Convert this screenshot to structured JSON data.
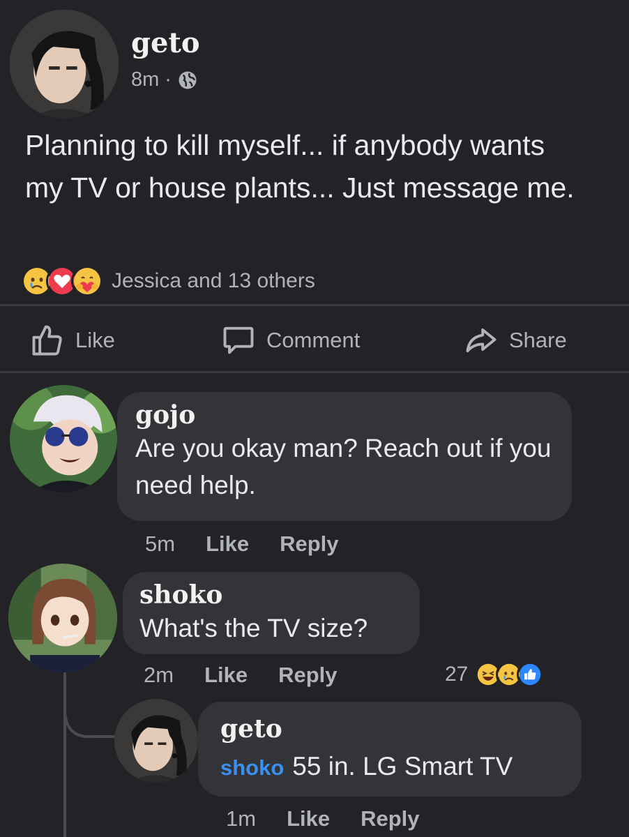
{
  "post": {
    "author": "geto",
    "time": "8m",
    "separator": "·",
    "text": "Planning to kill myself... if anybody wants my TV or house plants... Just message me.",
    "reactions": [
      "sad-reaction",
      "love-reaction",
      "care-reaction"
    ],
    "reaction_summary": "Jessica and 13 others"
  },
  "actions": {
    "like": "Like",
    "comment": "Comment",
    "share": "Share"
  },
  "comments": [
    {
      "author": "gojo",
      "text": "Are you okay man? Reach out if you need help.",
      "time": "5m",
      "like": "Like",
      "reply": "Reply"
    },
    {
      "author": "shoko",
      "text": "What's the TV size?",
      "time": "2m",
      "like": "Like",
      "reply": "Reply",
      "reaction_count": "27",
      "reactions": [
        "haha-reaction",
        "sad-reaction",
        "like-reaction"
      ]
    }
  ],
  "reply": {
    "author": "geto",
    "mention": "shoko",
    "text": "55 in. LG Smart TV",
    "time": "1m",
    "like": "Like",
    "reply": "Reply"
  },
  "colors": {
    "background": "#232327",
    "bubble": "#333438",
    "mention": "#3a90f0",
    "secondary_text": "#b0b3b8"
  }
}
